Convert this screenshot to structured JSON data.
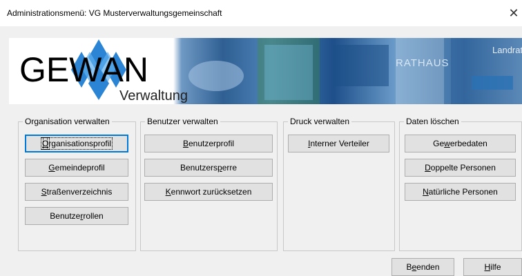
{
  "window": {
    "title": "Administrationsmenü: VG Musterverwaltungsgemeinschaft",
    "close_glyph": "✕"
  },
  "banner": {
    "logo_text": "GEWAN",
    "logo_sub": "Verwaltung",
    "photo_sign_1": "RATHAUS",
    "photo_sign_2": "Landrat",
    "logo_icon": "gewan-diamond-logo-icon"
  },
  "groups": [
    {
      "legend": "Organisation verwalten",
      "buttons": [
        {
          "pre": "",
          "acc": "O",
          "post": "rganisationsprofil",
          "focused": true
        },
        {
          "pre": "",
          "acc": "G",
          "post": "emeindeprofil"
        },
        {
          "pre": "",
          "acc": "S",
          "post": "traßenverzeichnis"
        },
        {
          "pre": "Benutze",
          "acc": "r",
          "post": "rollen"
        }
      ]
    },
    {
      "legend": "Benutzer verwalten",
      "buttons": [
        {
          "pre": "",
          "acc": "B",
          "post": "enutzerprofil"
        },
        {
          "pre": "Benutzers",
          "acc": "p",
          "post": "erre"
        },
        {
          "pre": "",
          "acc": "K",
          "post": "ennwort zurücksetzen"
        }
      ]
    },
    {
      "legend": "Druck verwalten",
      "buttons": [
        {
          "pre": "",
          "acc": "I",
          "post": "nterner Verteiler"
        }
      ]
    },
    {
      "legend": "Daten löschen",
      "buttons": [
        {
          "pre": "Ge",
          "acc": "w",
          "post": "erbedaten"
        },
        {
          "pre": "",
          "acc": "D",
          "post": "oppelte Personen"
        },
        {
          "pre": "",
          "acc": "N",
          "post": "atürliche Personen"
        }
      ]
    }
  ],
  "footer": {
    "quit": {
      "pre": "B",
      "acc": "e",
      "post": "enden"
    },
    "help": {
      "pre": "",
      "acc": "H",
      "post": "ilfe"
    }
  }
}
